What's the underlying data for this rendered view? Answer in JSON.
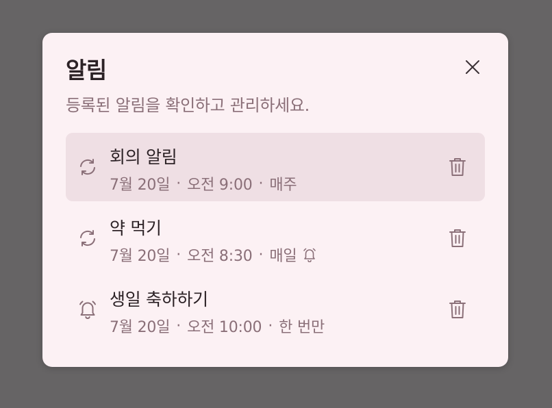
{
  "dialog": {
    "title": "알림",
    "subtitle": "등록된 알림을 확인하고 관리하세요.",
    "close_icon": "close-icon"
  },
  "alarms": [
    {
      "title": "회의 알림",
      "date": "7월 20일",
      "time": "오전 9:00",
      "repeat": "매주",
      "type_icon": "repeat-icon",
      "has_bell": false,
      "selected": true
    },
    {
      "title": "약 먹기",
      "date": "7월 20일",
      "time": "오전 8:30",
      "repeat": "매일",
      "type_icon": "repeat-icon",
      "has_bell": true,
      "selected": false
    },
    {
      "title": "생일 축하하기",
      "date": "7월 20일",
      "time": "오전 10:00",
      "repeat": "한 번만",
      "type_icon": "bell-icon",
      "has_bell": false,
      "selected": false
    }
  ],
  "colors": {
    "backdrop": "#666465",
    "dialog_bg": "#fcf1f4",
    "selected_bg": "#efdfe4",
    "text_primary": "#2c2226",
    "text_secondary": "#8a6f78"
  }
}
